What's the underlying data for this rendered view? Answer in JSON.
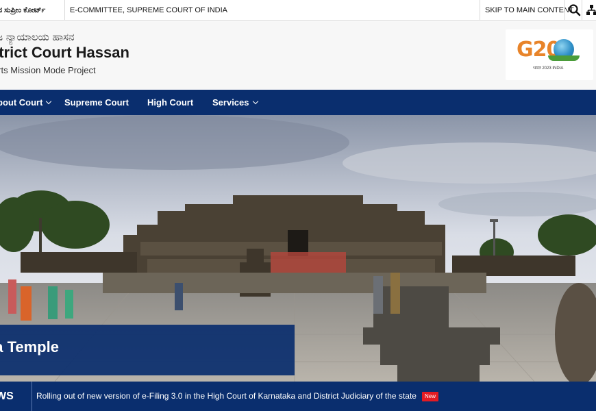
{
  "topbar": {
    "kannada_label": "ದ ಸುಪ್ರೀಂ ಕೋರ್ಟ್",
    "ecommittee": "E-COMMITTEE, SUPREME COURT OF INDIA",
    "skip": "SKIP TO MAIN CONTENT",
    "search_icon": "search-icon",
    "sitemap_icon": "sitemap-icon"
  },
  "header": {
    "kannada_title": "ಜ ನ್ಯಾಯಾಲಯ ಹಾಸನ",
    "title": "strict Court Hassan",
    "subtitle": "urts Mission Mode Project",
    "logo": {
      "text": "G20",
      "caption": "भारत 2023 INDIA"
    }
  },
  "nav": {
    "items": [
      {
        "label": "bout Court",
        "has_dropdown": true
      },
      {
        "label": "Supreme Court",
        "has_dropdown": false
      },
      {
        "label": "High Court",
        "has_dropdown": false
      },
      {
        "label": "Services",
        "has_dropdown": true
      }
    ]
  },
  "hero": {
    "caption": "va Temple"
  },
  "news": {
    "label": "WS",
    "text": "Rolling out of new version of e-Filing 3.0 in the High Court of Karnataka and District Judiciary of the state",
    "badge": "New"
  },
  "colors": {
    "navy": "#0a2e6e",
    "badge_red": "#e31b23",
    "g20_orange": "#e8842a"
  }
}
